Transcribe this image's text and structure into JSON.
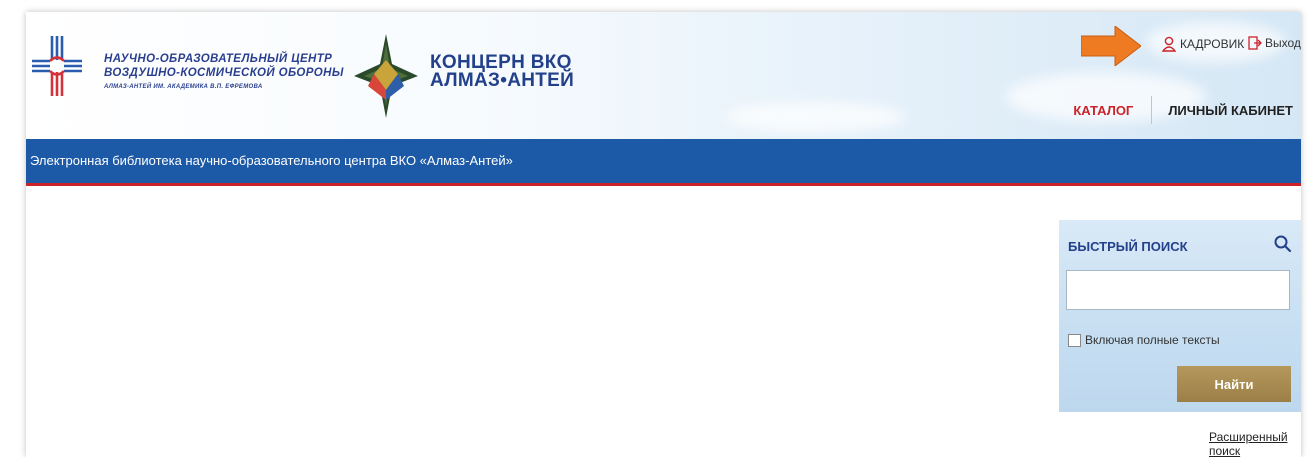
{
  "header": {
    "org1": {
      "line1": "НАУЧНО-ОБРАЗОВАТЕЛЬНЫЙ ЦЕНТР",
      "line2": "ВОЗДУШНО-КОСМИЧЕСКОЙ ОБОРОНЫ",
      "line3": "АЛМАЗ-АНТЕЙ ИМ. АКАДЕМИКА В.П. ЕФРЕМОВА"
    },
    "org2": {
      "line1": "КОНЦЕРН ВКО",
      "line2": "АЛМАЗ•АНТЕЙ"
    },
    "user_label": "КАДРОВИК",
    "exit_label": "Выход",
    "nav": {
      "catalog": "КАТАЛОГ",
      "cabinet": "ЛИЧНЫЙ КАБИНЕТ"
    }
  },
  "banner": {
    "title": "Электронная библиотека научно-образовательного центра ВКО «Алмаз-Антей»"
  },
  "quick_search": {
    "label": "БЫСТРЫЙ ПОИСК",
    "query_value": "",
    "fulltext_label": "Включая полные тексты",
    "fulltext_checked": false,
    "submit_label": "Найти"
  },
  "advanced_search_label": "Расширенный поиск",
  "colors": {
    "brand_blue": "#1c59a6",
    "accent_red": "#cc2229",
    "button_gold": "#a88a4f",
    "arrow_orange": "#ee7a22"
  },
  "icons": [
    "user-icon",
    "logout-icon",
    "search-icon",
    "arrow-icon"
  ]
}
